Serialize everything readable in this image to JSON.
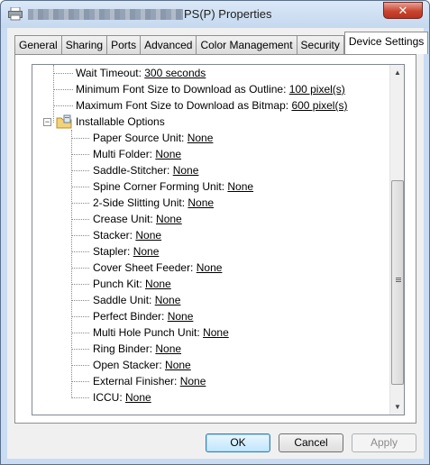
{
  "window": {
    "title_suffix": "PS(P) Properties",
    "close_glyph": "✕"
  },
  "tabs": [
    {
      "label": "General"
    },
    {
      "label": "Sharing"
    },
    {
      "label": "Ports"
    },
    {
      "label": "Advanced"
    },
    {
      "label": "Color Management"
    },
    {
      "label": "Security"
    },
    {
      "label": "Device Settings",
      "active": true
    }
  ],
  "tree": {
    "top_items": [
      {
        "label": "Wait Timeout: ",
        "value": "300 seconds"
      },
      {
        "label": "Minimum Font Size to Download as Outline: ",
        "value": "100 pixel(s)"
      },
      {
        "label": "Maximum Font Size to Download as Bitmap: ",
        "value": "600 pixel(s)"
      }
    ],
    "group": {
      "label": "Installable Options",
      "expander": "−"
    },
    "options": [
      {
        "label": "Paper Source Unit: ",
        "value": "None"
      },
      {
        "label": "Multi Folder: ",
        "value": "None"
      },
      {
        "label": "Saddle-Stitcher: ",
        "value": "None"
      },
      {
        "label": "Spine Corner Forming Unit: ",
        "value": "None"
      },
      {
        "label": "2-Side Slitting Unit: ",
        "value": "None"
      },
      {
        "label": "Crease Unit: ",
        "value": "None"
      },
      {
        "label": "Stacker: ",
        "value": "None"
      },
      {
        "label": "Stapler: ",
        "value": "None"
      },
      {
        "label": "Cover Sheet Feeder: ",
        "value": "None"
      },
      {
        "label": "Punch Kit: ",
        "value": "None"
      },
      {
        "label": "Saddle Unit: ",
        "value": "None"
      },
      {
        "label": "Perfect Binder: ",
        "value": "None"
      },
      {
        "label": "Multi Hole Punch Unit: ",
        "value": "None"
      },
      {
        "label": "Ring Binder: ",
        "value": "None"
      },
      {
        "label": "Open Stacker: ",
        "value": "None"
      },
      {
        "label": "External Finisher: ",
        "value": "None"
      },
      {
        "label": "ICCU: ",
        "value": "None"
      }
    ]
  },
  "scrollbar": {
    "up_glyph": "▲",
    "down_glyph": "▼"
  },
  "buttons": {
    "ok": "OK",
    "cancel": "Cancel",
    "apply": "Apply"
  },
  "colors": {
    "accent": "#3c7fb1",
    "window_frame": "#c9dcf1"
  }
}
